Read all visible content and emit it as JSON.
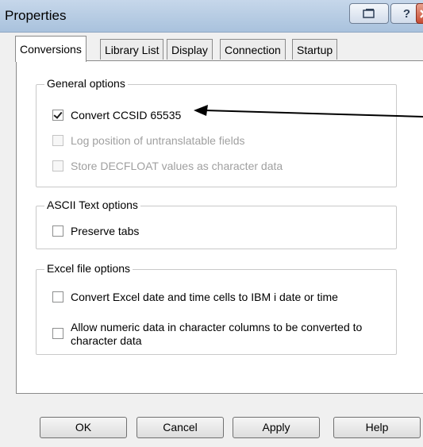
{
  "window": {
    "title": "Properties"
  },
  "titlebar": {
    "help_glyph": "?",
    "restore_icon": "restore-icon",
    "close_icon": "close-icon"
  },
  "tabs": [
    {
      "label": "Conversions",
      "active": true
    },
    {
      "label": "Library List",
      "active": false
    },
    {
      "label": "Display",
      "active": false
    },
    {
      "label": "Connection",
      "active": false
    },
    {
      "label": "Startup",
      "active": false
    }
  ],
  "general": {
    "legend": "General options",
    "options": [
      {
        "label": "Convert CCSID 65535",
        "checked": true,
        "enabled": true
      },
      {
        "label": "Log position of untranslatable fields",
        "checked": false,
        "enabled": false
      },
      {
        "label": "Store DECFLOAT values as character data",
        "checked": false,
        "enabled": false
      }
    ]
  },
  "ascii": {
    "legend": "ASCII Text options",
    "options": [
      {
        "label": "Preserve tabs",
        "checked": false,
        "enabled": true
      }
    ]
  },
  "excel": {
    "legend": "Excel file options",
    "options": [
      {
        "label": "Convert Excel date and time cells to IBM i date or time",
        "checked": false,
        "enabled": true
      },
      {
        "label_line1": "Allow numeric data in character columns to be converted to",
        "label_line2": "character data",
        "checked": false,
        "enabled": true
      }
    ]
  },
  "buttons": {
    "ok": "OK",
    "cancel": "Cancel",
    "apply": "Apply",
    "help": "Help"
  }
}
